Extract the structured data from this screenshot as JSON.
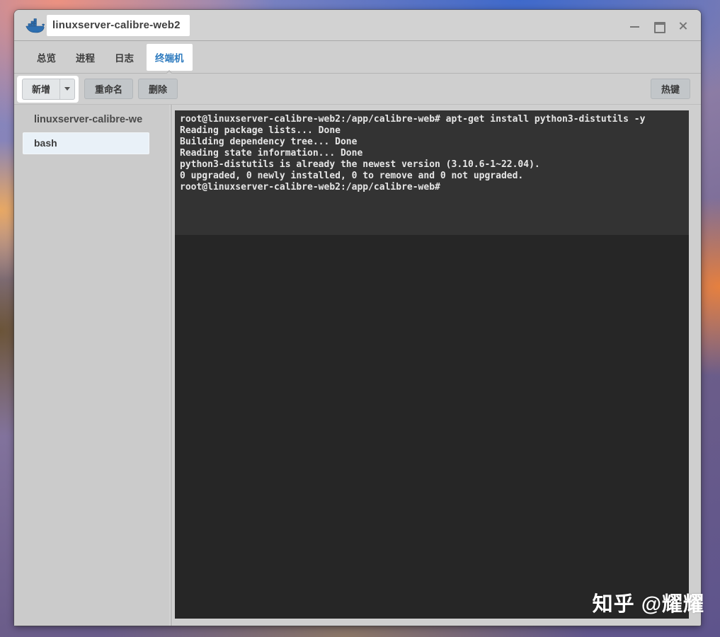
{
  "window": {
    "title": "linuxserver-calibre-web2",
    "controls": {
      "minimize_icon": "minimize-icon",
      "maximize_icon": "maximize-icon",
      "close_icon": "close-icon"
    },
    "app_icon": "docker-whale-icon"
  },
  "tabs": [
    {
      "label": "总览",
      "active": false
    },
    {
      "label": "进程",
      "active": false
    },
    {
      "label": "日志",
      "active": false
    },
    {
      "label": "终端机",
      "active": true
    }
  ],
  "toolbar": {
    "add": "新增",
    "add_dropdown_icon": "caret-down-icon",
    "rename": "重命名",
    "delete": "删除",
    "hotkey": "热键"
  },
  "sidebar": {
    "header": "linuxserver-calibre-we",
    "items": [
      {
        "label": "bash",
        "selected": true
      }
    ]
  },
  "terminal": {
    "lines": [
      "root@linuxserver-calibre-web2:/app/calibre-web# apt-get install python3-distutils -y",
      "Reading package lists... Done",
      "Building dependency tree... Done",
      "Reading state information... Done",
      "python3-distutils is already the newest version (3.10.6-1~22.04).",
      "0 upgraded, 0 newly installed, 0 to remove and 0 not upgraded.",
      "root@linuxserver-calibre-web2:/app/calibre-web#"
    ]
  },
  "watermark": "知乎 @耀耀",
  "colors": {
    "accent_blue": "#2e7bbf",
    "window_bg": "#cfcfcf",
    "terminal_bg": "#262626",
    "terminal_screen_bg": "#333333",
    "terminal_text": "#e6e6e6",
    "selected_item_bg": "#e9f1f8"
  }
}
